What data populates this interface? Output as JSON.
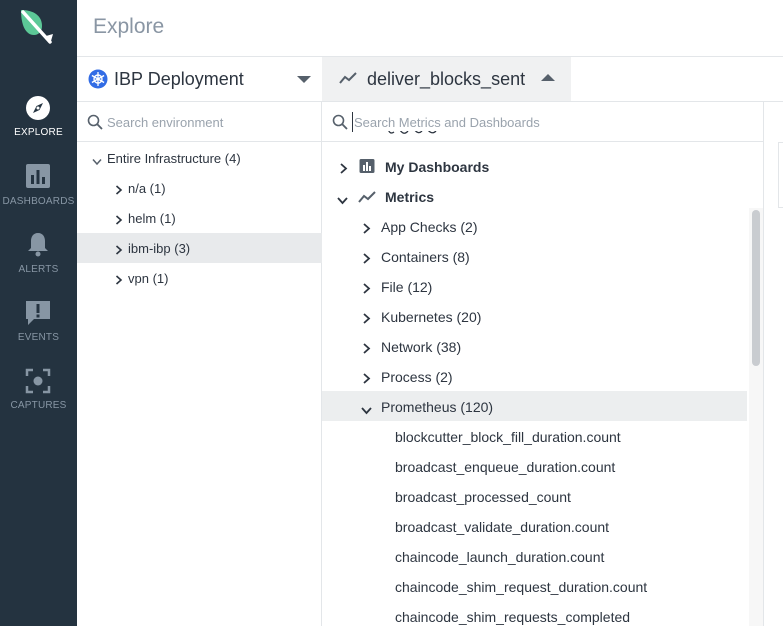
{
  "header": {
    "title": "Explore"
  },
  "nav": {
    "items": [
      {
        "label": "EXPLORE",
        "icon": "compass-icon",
        "active": true
      },
      {
        "label": "DASHBOARDS",
        "icon": "bar-chart-icon",
        "active": false
      },
      {
        "label": "ALERTS",
        "icon": "bell-icon",
        "active": false
      },
      {
        "label": "EVENTS",
        "icon": "exclamation-bubble-icon",
        "active": false
      },
      {
        "label": "CAPTURES",
        "icon": "capture-frame-icon",
        "active": false
      }
    ]
  },
  "environment": {
    "selected": "IBP Deployment",
    "search_placeholder": "Search environment",
    "tree": [
      {
        "label": "Entire Infrastructure (4)",
        "expanded": true
      },
      {
        "label": "n/a (1)",
        "expanded": false
      },
      {
        "label": "helm (1)",
        "expanded": false
      },
      {
        "label": "ibm-ibp (3)",
        "expanded": false,
        "selected": true
      },
      {
        "label": "vpn (1)",
        "expanded": false
      }
    ]
  },
  "metric": {
    "selected": "deliver_blocks_sent",
    "search_placeholder": "Search Metrics and Dashboards",
    "groups": [
      {
        "label": "My Dashboards",
        "expanded": false
      },
      {
        "label": "Metrics",
        "expanded": true
      }
    ],
    "categories": [
      {
        "label": "App Checks (2)",
        "expanded": false
      },
      {
        "label": "Containers (8)",
        "expanded": false
      },
      {
        "label": "File (12)",
        "expanded": false
      },
      {
        "label": "Kubernetes (20)",
        "expanded": false
      },
      {
        "label": "Network (38)",
        "expanded": false
      },
      {
        "label": "Process (2)",
        "expanded": false
      },
      {
        "label": "Prometheus (120)",
        "expanded": true,
        "selected": true
      }
    ],
    "prometheus_metrics": [
      "blockcutter_block_fill_duration.count",
      "broadcast_enqueue_duration.count",
      "broadcast_processed_count",
      "broadcast_validate_duration.count",
      "chaincode_launch_duration.count",
      "chaincode_shim_request_duration.count",
      "chaincode_shim_requests_completed"
    ]
  },
  "colors": {
    "nav_bg": "#243340",
    "logo_green": "#5cc897",
    "k8s_blue": "#326ce5",
    "selected_row": "#e8eaec"
  }
}
